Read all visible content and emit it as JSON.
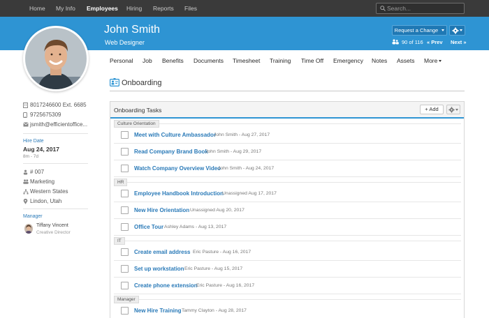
{
  "topnav": {
    "items": [
      "Home",
      "My Info",
      "Employees",
      "Hiring",
      "Reports",
      "Files"
    ],
    "active": "Employees",
    "search_placeholder": "Search..."
  },
  "employee": {
    "name": "John Smith",
    "title": "Web Designer",
    "request_change_label": "Request a Change",
    "pager": {
      "count": "90 of 116",
      "prev": "« Prev",
      "next": "Next »"
    }
  },
  "tabs": [
    "Personal",
    "Job",
    "Benefits",
    "Documents",
    "Timesheet",
    "Training",
    "Time Off",
    "Emergency",
    "Notes",
    "Assets",
    "More"
  ],
  "sidebar": {
    "phone_work": "8017246600 Ext. 6685",
    "phone_mobile": "9725675309",
    "email": "jsmith@efficientoffice...",
    "hire_date_label": "Hire Date",
    "hire_date": "Aug 24, 2017",
    "tenure": "8m - 7d",
    "employee_number": "# 007",
    "department": "Marketing",
    "division": "Western States",
    "location": "Lindon, Utah",
    "manager_label": "Manager",
    "manager_name": "Tiffany Vincent",
    "manager_title": "Creative Director"
  },
  "section": {
    "title": "Onboarding"
  },
  "panel": {
    "title": "Onboarding Tasks",
    "add_label": "+ Add",
    "groups": [
      {
        "label": "Culture Orientation",
        "tasks": [
          {
            "name": "Meet with Culture Ambassador",
            "meta": "John Smith - Aug 27, 2017"
          },
          {
            "name": "Read Company Brand Book",
            "meta": "John Smith - Aug 29, 2017"
          },
          {
            "name": "Watch Company Overview Video",
            "meta": "John Smith - Aug 24, 2017"
          }
        ]
      },
      {
        "label": "HR",
        "tasks": [
          {
            "name": "Employee Handbook Introduction",
            "meta": "Unassigned Aug 17, 2017"
          },
          {
            "name": "New Hire Orientation",
            "meta": "Unassigned Aug 20, 2017"
          },
          {
            "name": "Office Tour",
            "meta": "Ashley Adams - Aug 13, 2017"
          }
        ]
      },
      {
        "label": "IT",
        "tasks": [
          {
            "name": "Create email address",
            "meta": "Eric Pasture - Aug 16, 2017"
          },
          {
            "name": "Set up workstation",
            "meta": "Eric Pasture - Aug 15, 2017"
          },
          {
            "name": "Create phone extension",
            "meta": "Eric Pasture - Aug 16, 2017"
          }
        ]
      },
      {
        "label": "Manager",
        "tasks": [
          {
            "name": "New Hire Training",
            "meta": "Tammy Clayton - Aug 28, 2017"
          }
        ]
      }
    ]
  },
  "colors": {
    "header_blue": "#2e94d3",
    "link_blue": "#2a7ab8",
    "nav_dark": "#3a3a3a"
  }
}
